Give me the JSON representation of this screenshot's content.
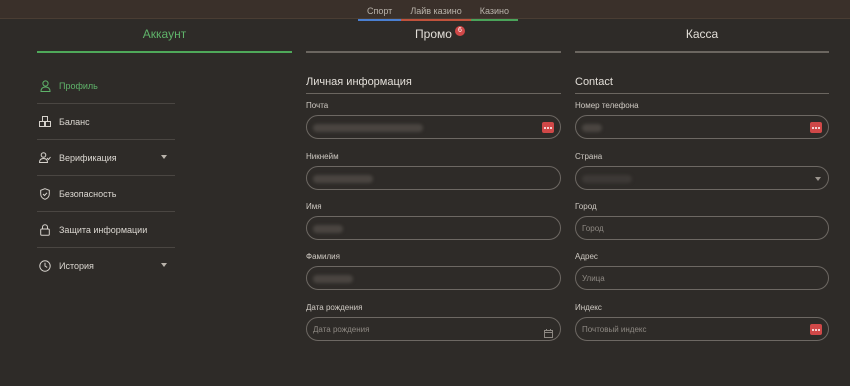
{
  "topnav": {
    "sport": "Спорт",
    "live_casino": "Лайв казино",
    "casino": "Казино"
  },
  "tabs": {
    "account": "Аккаунт",
    "promo": "Промо",
    "promo_badge": "6",
    "cashier": "Касса"
  },
  "sidebar": {
    "items": [
      {
        "label": "Профиль",
        "icon": "user-icon"
      },
      {
        "label": "Баланс",
        "icon": "coins-icon"
      },
      {
        "label": "Верификация",
        "icon": "user-check-icon"
      },
      {
        "label": "Безопасность",
        "icon": "shield-icon"
      },
      {
        "label": "Защита информации",
        "icon": "lock-icon"
      },
      {
        "label": "История",
        "icon": "clock-history-icon"
      }
    ]
  },
  "personal": {
    "title": "Личная информация",
    "email_label": "Почта",
    "nickname_label": "Никнейм",
    "name_label": "Имя",
    "surname_label": "Фамилия",
    "birthdate_label": "Дата рождения",
    "birthdate_placeholder": "Дата рождения"
  },
  "contact": {
    "title": "Contact",
    "phone_label": "Номер телефона",
    "country_label": "Страна",
    "city_label": "Город",
    "city_placeholder": "Город",
    "address_label": "Адрес",
    "address_placeholder": "Улица",
    "zip_label": "Индекс",
    "zip_placeholder": "Почтовый индекс"
  },
  "colors": {
    "background": "#2e2b28",
    "accent_green": "#4fa95a",
    "badge_red": "#d04848"
  }
}
